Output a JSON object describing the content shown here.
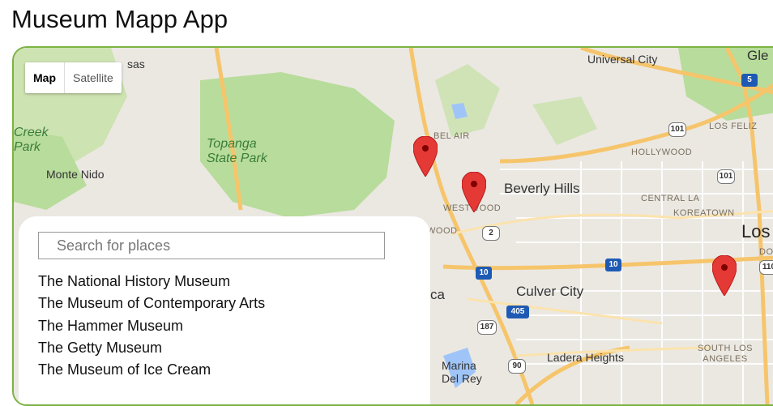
{
  "app": {
    "title": "Museum Mapp App"
  },
  "map_type": {
    "map_label": "Map",
    "satellite_label": "Satellite",
    "selected": "Map"
  },
  "search": {
    "placeholder": "Search for places",
    "value": ""
  },
  "places": [
    "The National History Museum",
    "The Museum of Contemporary Arts",
    "The Hammer Museum",
    "The Getty Museum",
    "The Museum of Ice Cream"
  ],
  "map_labels": {
    "universal_city": "Universal City",
    "glendale": "Gle",
    "calabasas_frag": "sas",
    "creek_park": "Creek Park",
    "monte_nido": "Monte Nido",
    "topanga": "Topanga State Park",
    "bel_air": "BEL AIR",
    "beverly_hills": "Beverly Hills",
    "westwood": "WESTWOOD",
    "westwood_frag": "WOOD",
    "hollywood": "HOLLYWOOD",
    "los_feliz": "LOS FELIZ",
    "central_la": "CENTRAL LA",
    "koreatown": "KOREATOWN",
    "los_angeles_frag": "Los",
    "do_frag": "DO",
    "culver_city": "Culver City",
    "ca_frag": "ca",
    "ladera_heights": "Ladera Heights",
    "marina_del_rey": "Marina Del Rey",
    "south_los_angeles": "SOUTH LOS ANGELES"
  },
  "shields": [
    "5",
    "101",
    "101",
    "2",
    "10",
    "10",
    "405",
    "187",
    "90",
    "110"
  ],
  "colors": {
    "frame_border": "#7cb342",
    "marker": "#e53935",
    "park": "#b8dc9b",
    "highway": "#f6c56b",
    "road": "#ffffff",
    "water": "#9fc5f8"
  }
}
